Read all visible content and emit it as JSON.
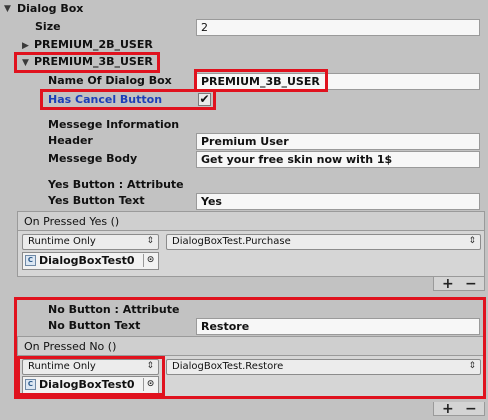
{
  "inspector": {
    "header": "Dialog Box",
    "size_label": "Size",
    "size_value": "2",
    "element_0": "PREMIUM_2B_USER",
    "element_1": "PREMIUM_3B_USER",
    "fields": {
      "name_label": "Name Of Dialog Box",
      "name_value": "PREMIUM_3B_USER",
      "cancel_label": "Has Cancel Button",
      "cancel_checked": "✔",
      "info_header": "Messege Information",
      "header_label": "Header",
      "header_value": "Premium User",
      "body_label": "Messege Body",
      "body_value": "Get your free skin now with 1$",
      "yes_header": "Yes Button : Attribute",
      "yes_text_label": "Yes Button Text",
      "yes_text_value": "Yes",
      "no_header": "No Button : Attribute",
      "no_text_label": "No Button Text",
      "no_text_value": "Restore"
    },
    "yes_event": {
      "title": "On Pressed Yes ()",
      "mode": "Runtime Only",
      "function": "DialogBoxTest.Purchase",
      "object": "DialogBoxTest0",
      "add": "+",
      "remove": "−"
    },
    "no_event": {
      "title": "On Pressed No ()",
      "mode": "Runtime Only",
      "function": "DialogBoxTest.Restore",
      "object": "DialogBoxTest0",
      "add": "+",
      "remove": "−"
    }
  },
  "colors": {
    "highlight_box": "#e0121e",
    "cancel_label_color": "#1c3fb8"
  }
}
